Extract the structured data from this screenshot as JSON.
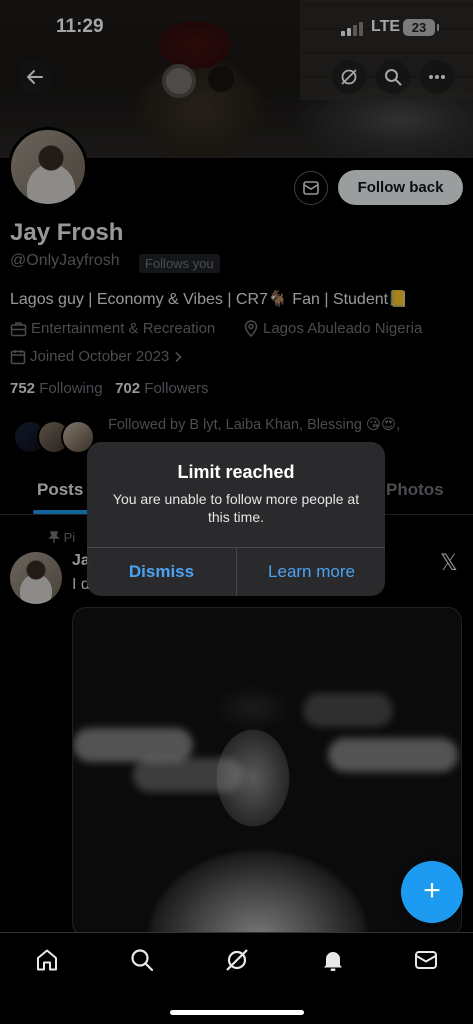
{
  "status_bar": {
    "time": "11:29",
    "network": "LTE",
    "battery": "23"
  },
  "header": {
    "back_icon": "arrow-left-icon",
    "grok_icon": "grok-icon",
    "search_icon": "search-icon",
    "more_icon": "more-icon"
  },
  "profile": {
    "name": "Jay Frosh",
    "handle": "@OnlyJayfrosh",
    "follows_you": "Follows you",
    "follow_back_label": "Follow back",
    "bio": "Lagos guy | Economy & Vibes | CR7🐐 Fan | Student📒",
    "category": "Entertainment & Recreation",
    "location": "Lagos Abuleado Nigeria",
    "joined": "Joined October 2023",
    "following_count": "752",
    "following_label": "Following",
    "followers_count": "702",
    "followers_label": "Followers",
    "followed_by": "Followed by B lyt, Laiba Khan, Blessing 😘😍,"
  },
  "tabs": {
    "posts": "Posts",
    "photos": "Photos"
  },
  "pinned_post": {
    "pinned_label": "Pi",
    "author": "Ja",
    "text": "I d"
  },
  "dialog": {
    "title": "Limit reached",
    "message": "You are unable to follow more people at this time.",
    "dismiss": "Dismiss",
    "learn_more": "Learn more"
  },
  "fab": {
    "label": "+"
  },
  "bottom_nav": [
    "home-icon",
    "search-icon",
    "grok-icon",
    "notifications-icon",
    "messages-icon"
  ],
  "colors": {
    "accent": "#1d9bf0",
    "dialog_link": "#4aa3f2",
    "muted": "#71767b"
  }
}
